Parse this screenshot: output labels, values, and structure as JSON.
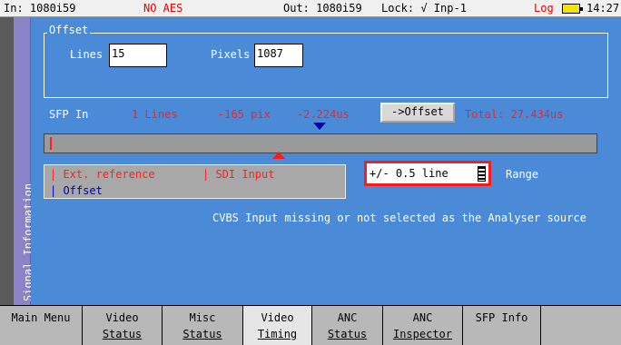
{
  "status_bar": {
    "input": "In: 1080i59",
    "aes_status": "NO AES",
    "output": "Out: 1080i59",
    "lock": "Lock: √ Inp-1",
    "log": "Log",
    "battery_icon": "battery-icon",
    "time": "14:27"
  },
  "side_panel": {
    "label": "Signal Information"
  },
  "offset": {
    "legend": "Offset",
    "lines_label": "Lines",
    "lines_value": "15",
    "pixels_label": "Pixels",
    "pixels_value": "1087"
  },
  "sfp": {
    "label": "SFP In",
    "lines": "1 Lines",
    "pix": "-165 pix",
    "us": "-2.224us",
    "offset_button": "->Offset",
    "total": "Total: 27.434us"
  },
  "legend": {
    "ext_ref": "| Ext. reference",
    "sdi_input": "| SDI Input",
    "offset": "| Offset"
  },
  "range": {
    "value": "+/- 0.5 line",
    "label": "Range"
  },
  "message": "CVBS Input missing or not selected as the Analyser source",
  "colors": {
    "panel_bg": "#4a8ad6",
    "warning_red": "#ff2020",
    "offset_blue": "#0000b0",
    "side_strip": "#8c82c8"
  },
  "nav": [
    {
      "line1": "Main Menu",
      "line2": ""
    },
    {
      "line1": "Video",
      "line2": "Status"
    },
    {
      "line1": "Misc",
      "line2": "Status"
    },
    {
      "line1": "Video",
      "line2": "Timing"
    },
    {
      "line1": "ANC",
      "line2": "Status"
    },
    {
      "line1": "ANC",
      "line2": "Inspector"
    },
    {
      "line1": "SFP Info",
      "line2": ""
    },
    {
      "line1": "",
      "line2": ""
    }
  ]
}
